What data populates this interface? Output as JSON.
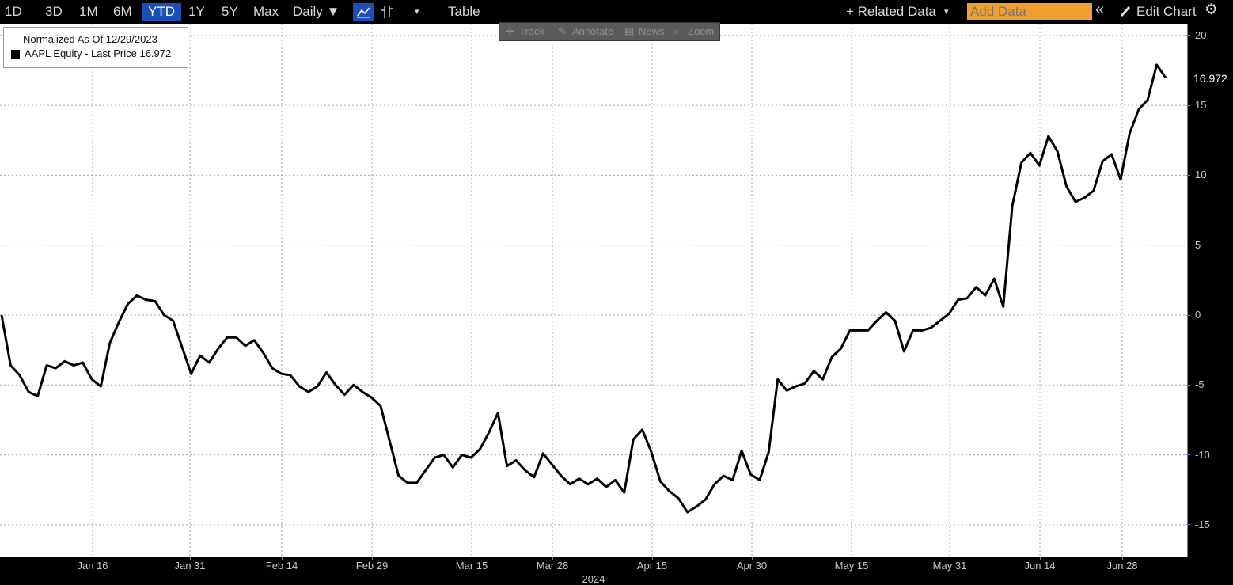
{
  "toolbar": {
    "ranges": [
      "1D",
      "3D",
      "1M",
      "6M",
      "YTD",
      "1Y",
      "5Y",
      "Max"
    ],
    "active_range": "YTD",
    "frequency": "Daily ▼",
    "table": "Table",
    "related_data": "+ Related Data",
    "add_data_placeholder": "Add Data",
    "collapse": "«",
    "edit_chart": "Edit Chart"
  },
  "mini_toolbar": {
    "track": "Track",
    "annotate": "Annotate",
    "news": "News",
    "zoom": "Zoom"
  },
  "legend": {
    "title": "Normalized As Of 12/29/2023",
    "entry": "AAPL Equity - Last Price 16.972"
  },
  "last_price_label": "16.972",
  "chart_data": {
    "type": "line",
    "series": [
      {
        "name": "AAPL Equity - Last Price",
        "color": "#000000",
        "values": [
          0.0,
          -3.6,
          -4.3,
          -5.5,
          -5.8,
          -3.6,
          -3.8,
          -3.3,
          -3.6,
          -3.4,
          -4.6,
          -5.1,
          -2.0,
          -0.5,
          0.8,
          1.4,
          1.1,
          1.0,
          0.0,
          -0.4,
          -2.3,
          -4.2,
          -2.9,
          -3.4,
          -2.4,
          -1.6,
          -1.6,
          -2.2,
          -1.8,
          -2.7,
          -3.8,
          -4.2,
          -4.3,
          -5.1,
          -5.5,
          -5.1,
          -4.1,
          -5.0,
          -5.7,
          -5.0,
          -5.5,
          -5.9,
          -6.5,
          -9.0,
          -11.5,
          -12.0,
          -12.0,
          -11.1,
          -10.2,
          -10.0,
          -10.9,
          -10.0,
          -10.2,
          -9.6,
          -8.4,
          -7.0,
          -10.8,
          -10.4,
          -11.1,
          -11.6,
          -9.9,
          -10.7,
          -11.5,
          -12.1,
          -11.7,
          -12.1,
          -11.7,
          -12.3,
          -11.8,
          -12.7,
          -8.9,
          -8.2,
          -9.8,
          -11.9,
          -12.6,
          -13.1,
          -14.1,
          -13.7,
          -13.2,
          -12.1,
          -11.5,
          -11.8,
          -9.7,
          -11.4,
          -11.8,
          -9.8,
          -4.6,
          -5.4,
          -5.1,
          -4.9,
          -4.0,
          -4.6,
          -3.0,
          -2.4,
          -1.1,
          -1.1,
          -1.1,
          -0.4,
          0.2,
          -0.4,
          -2.6,
          -1.1,
          -1.1,
          -0.9,
          -0.4,
          0.1,
          1.1,
          1.2,
          2.0,
          1.4,
          2.6,
          0.6,
          7.8,
          10.9,
          11.6,
          10.7,
          12.8,
          11.7,
          9.2,
          8.1,
          8.4,
          8.9,
          11.0,
          11.5,
          9.7,
          13.0,
          14.7,
          15.4,
          17.9,
          16.972
        ]
      }
    ],
    "x_labels": [
      "Jan 16",
      "Jan 31",
      "Feb 14",
      "Feb 29",
      "Mar 15",
      "Mar 28",
      "Apr 15",
      "Apr 30",
      "May 15",
      "May 31",
      "Jun 14",
      "Jun 28"
    ],
    "x_title": "2024",
    "y_ticks": [
      20,
      15,
      10,
      5,
      0,
      -5,
      -10,
      -15
    ],
    "ylim": [
      -16.5,
      20.5
    ],
    "grid": true,
    "legend_position": "top-left"
  }
}
